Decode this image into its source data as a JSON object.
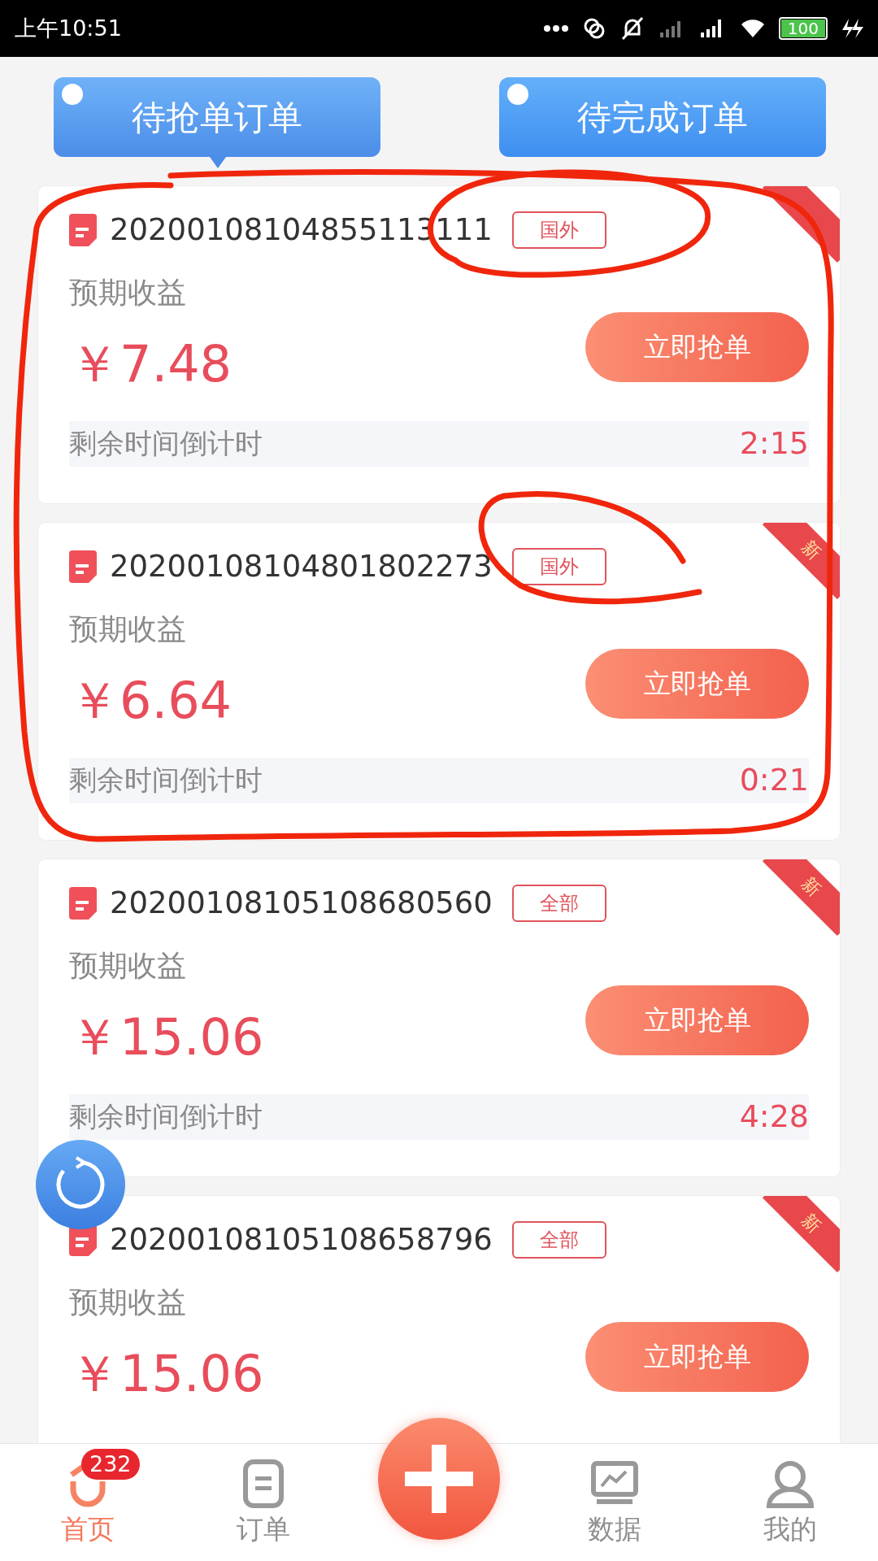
{
  "status_bar": {
    "time": "上午10:51",
    "battery": "100"
  },
  "tabs": [
    {
      "label": "待抢单订单",
      "selected": true
    },
    {
      "label": "待完成订单",
      "selected": false
    }
  ],
  "orders": [
    {
      "order_no": "20200108104855113111",
      "tag": "国外",
      "income_label": "预期收益",
      "amount": "￥7.48",
      "button": "立即抢单",
      "countdown_label": "剩余时间倒计时",
      "countdown": "2:15"
    },
    {
      "order_no": "20200108104801802273",
      "tag": "国外",
      "ribbon": "新",
      "income_label": "预期收益",
      "amount": "￥6.64",
      "button": "立即抢单",
      "countdown_label": "剩余时间倒计时",
      "countdown": "0:21"
    },
    {
      "order_no": "20200108105108680560",
      "tag": "全部",
      "ribbon": "新",
      "income_label": "预期收益",
      "amount": "￥15.06",
      "button": "立即抢单",
      "countdown_label": "剩余时间倒计时",
      "countdown": "4:28"
    },
    {
      "order_no": "20200108105108658796",
      "tag": "全部",
      "ribbon": "新",
      "income_label": "预期收益",
      "amount": "￥15.06",
      "button": "立即抢单"
    }
  ],
  "bottom_nav": [
    {
      "kind": "home",
      "label": "首页",
      "badge": "232",
      "selected": true
    },
    {
      "kind": "orders",
      "label": "订单",
      "selected": false
    },
    {
      "kind": "add"
    },
    {
      "kind": "data",
      "label": "数据",
      "selected": false
    },
    {
      "kind": "me",
      "label": "我的",
      "selected": false
    }
  ]
}
